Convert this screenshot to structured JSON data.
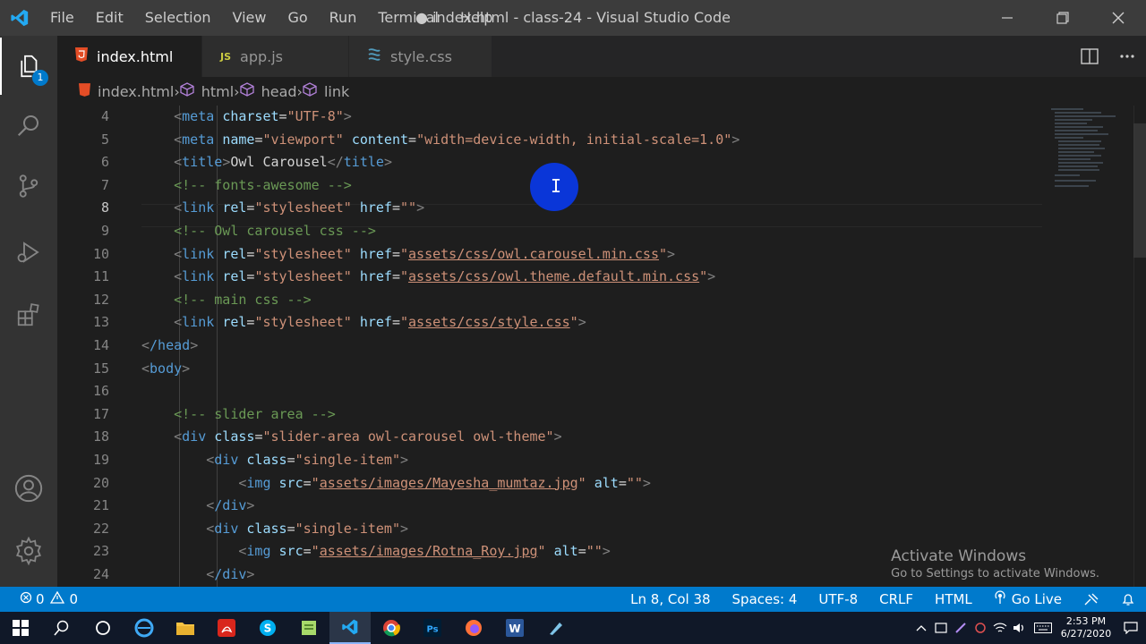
{
  "menu": [
    "File",
    "Edit",
    "Selection",
    "View",
    "Go",
    "Run",
    "Terminal",
    "Help"
  ],
  "window_title": "● index.html - class-24 - Visual Studio Code",
  "tabs": [
    {
      "label": "index.html",
      "icon": "html5-icon",
      "color": "#e44d26",
      "active": true,
      "modified": true
    },
    {
      "label": "app.js",
      "icon": "js-icon",
      "color": "#cbcb41",
      "active": false,
      "modified": false
    },
    {
      "label": "style.css",
      "icon": "css3-icon",
      "color": "#519aba",
      "active": false,
      "modified": false
    }
  ],
  "breadcrumb": [
    "index.html",
    "html",
    "head",
    "link"
  ],
  "activity_badge": "1",
  "line_numbers": [
    "4",
    "5",
    "6",
    "7",
    "8",
    "9",
    "10",
    "11",
    "12",
    "13",
    "14",
    "15",
    "16",
    "17",
    "18",
    "19",
    "20",
    "21",
    "22",
    "23",
    "24"
  ],
  "current_line": "8",
  "code": {
    "l4_tag": "meta",
    "l4_attr": "charset",
    "l4_val": "\"UTF-8\"",
    "l5_tag": "meta",
    "l5_attr1": "name",
    "l5_val1": "\"viewport\"",
    "l5_attr2": "content",
    "l5_val2": "\"width=device-width, initial-scale=1.0\"",
    "l6_tag": "title",
    "l6_text": "Owl Carousel",
    "l7_comment": "<!-- fonts-awesome -->",
    "l8_tag": "link",
    "l8_attr1": "rel",
    "l8_val1": "\"stylesheet\"",
    "l8_attr2": "href",
    "l8_val2": "\"\"",
    "l9_comment": "<!-- Owl carousel css -->",
    "l10_tag": "link",
    "l10_attr1": "rel",
    "l10_val1": "\"stylesheet\"",
    "l10_attr2": "href",
    "l10_val2": "assets/css/owl.carousel.min.css",
    "l11_tag": "link",
    "l11_attr1": "rel",
    "l11_val1": "\"stylesheet\"",
    "l11_attr2": "href",
    "l11_val2": "assets/css/owl.theme.default.min.css",
    "l12_comment": "<!-- main css -->",
    "l13_tag": "link",
    "l13_attr1": "rel",
    "l13_val1": "\"stylesheet\"",
    "l13_attr2": "href",
    "l13_val2": "assets/css/style.css",
    "l14_tag": "/head",
    "l15_tag": "body",
    "l17_comment": "<!-- slider area -->",
    "l18_tag": "div",
    "l18_attr": "class",
    "l18_val": "\"slider-area owl-carousel owl-theme\"",
    "l19_tag": "div",
    "l19_attr": "class",
    "l19_val": "\"single-item\"",
    "l20_tag": "img",
    "l20_attr1": "src",
    "l20_val1": "assets/images/Mayesha_mumtaz.jpg",
    "l20_attr2": "alt",
    "l20_val2": "\"\"",
    "l21_tag": "/div",
    "l22_tag": "div",
    "l22_attr": "class",
    "l22_val": "\"single-item\"",
    "l23_tag": "img",
    "l23_attr1": "src",
    "l23_val1": "assets/images/Rotna_Roy.jpg",
    "l23_attr2": "alt",
    "l23_val2": "\"\"",
    "l24_tag": "/div"
  },
  "activate_windows": {
    "line1": "Activate Windows",
    "line2": "Go to Settings to activate Windows."
  },
  "status": {
    "errors": "0",
    "warnings": "0",
    "position": "Ln 8, Col 38",
    "spaces": "Spaces: 4",
    "encoding": "UTF-8",
    "eol": "CRLF",
    "language": "HTML",
    "golive": "Go Live"
  },
  "clock": {
    "time": "2:53 PM",
    "date": "6/27/2020"
  },
  "colors": {
    "accent": "#007acc",
    "titlebar": "#3c3c3c",
    "editor": "#1e1e1e"
  }
}
